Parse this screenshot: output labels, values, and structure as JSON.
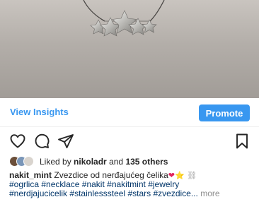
{
  "post": {
    "insights_label": "View Insights",
    "promote_label": "Promote"
  },
  "actions": {
    "like_icon": "heart-outline-icon",
    "comment_icon": "comment-icon",
    "share_icon": "paper-plane-icon",
    "save_icon": "bookmark-icon"
  },
  "likes": {
    "prefix": "Liked by",
    "user": "nikoladr",
    "conjunction": "and",
    "others": "135 others"
  },
  "caption": {
    "username": "nakit_mint",
    "text": "Zvezdice od nerđajućeg čelika",
    "emoji_1": "❤",
    "emoji_2": "⭐",
    "emoji_3": "⛓",
    "line2_tags": [
      "#ogrlica",
      "#necklace",
      "#nakit",
      "#nakitmint",
      "#jewelry"
    ],
    "line3_tags": [
      "#nerdjajucicelik",
      "#stainlesssteel",
      "#stars",
      "#zvezdice..."
    ],
    "more_label": "more"
  },
  "colors": {
    "accent": "#3897f0",
    "hashtag": "#003569",
    "muted": "#8e8e8e"
  }
}
